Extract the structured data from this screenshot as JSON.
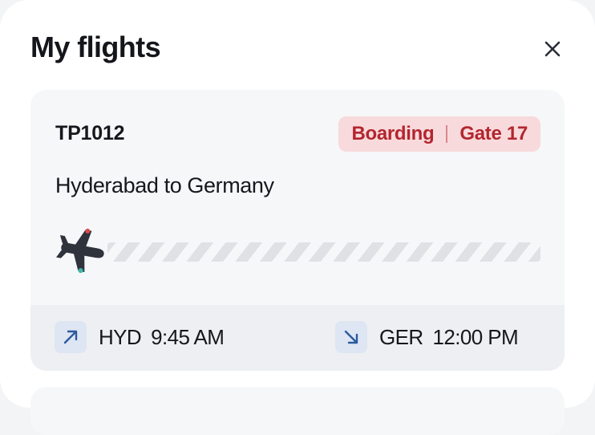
{
  "header": {
    "title": "My flights",
    "close_icon": "close-icon"
  },
  "flight": {
    "number": "TP1012",
    "status": "Boarding",
    "gate": "Gate 17",
    "route": "Hyderabad to Germany",
    "progress": 0,
    "departure": {
      "code": "HYD",
      "time": "9:45 AM",
      "icon": "arrow-up-right-icon"
    },
    "arrival": {
      "code": "GER",
      "time": "12:00 PM",
      "icon": "arrow-down-right-icon"
    }
  },
  "colors": {
    "status_bg": "#f8dadc",
    "status_text": "#b3262f",
    "plane": "#2e333c",
    "leg_icon_bg": "#dde6f2",
    "leg_icon": "#2c5aa0"
  }
}
